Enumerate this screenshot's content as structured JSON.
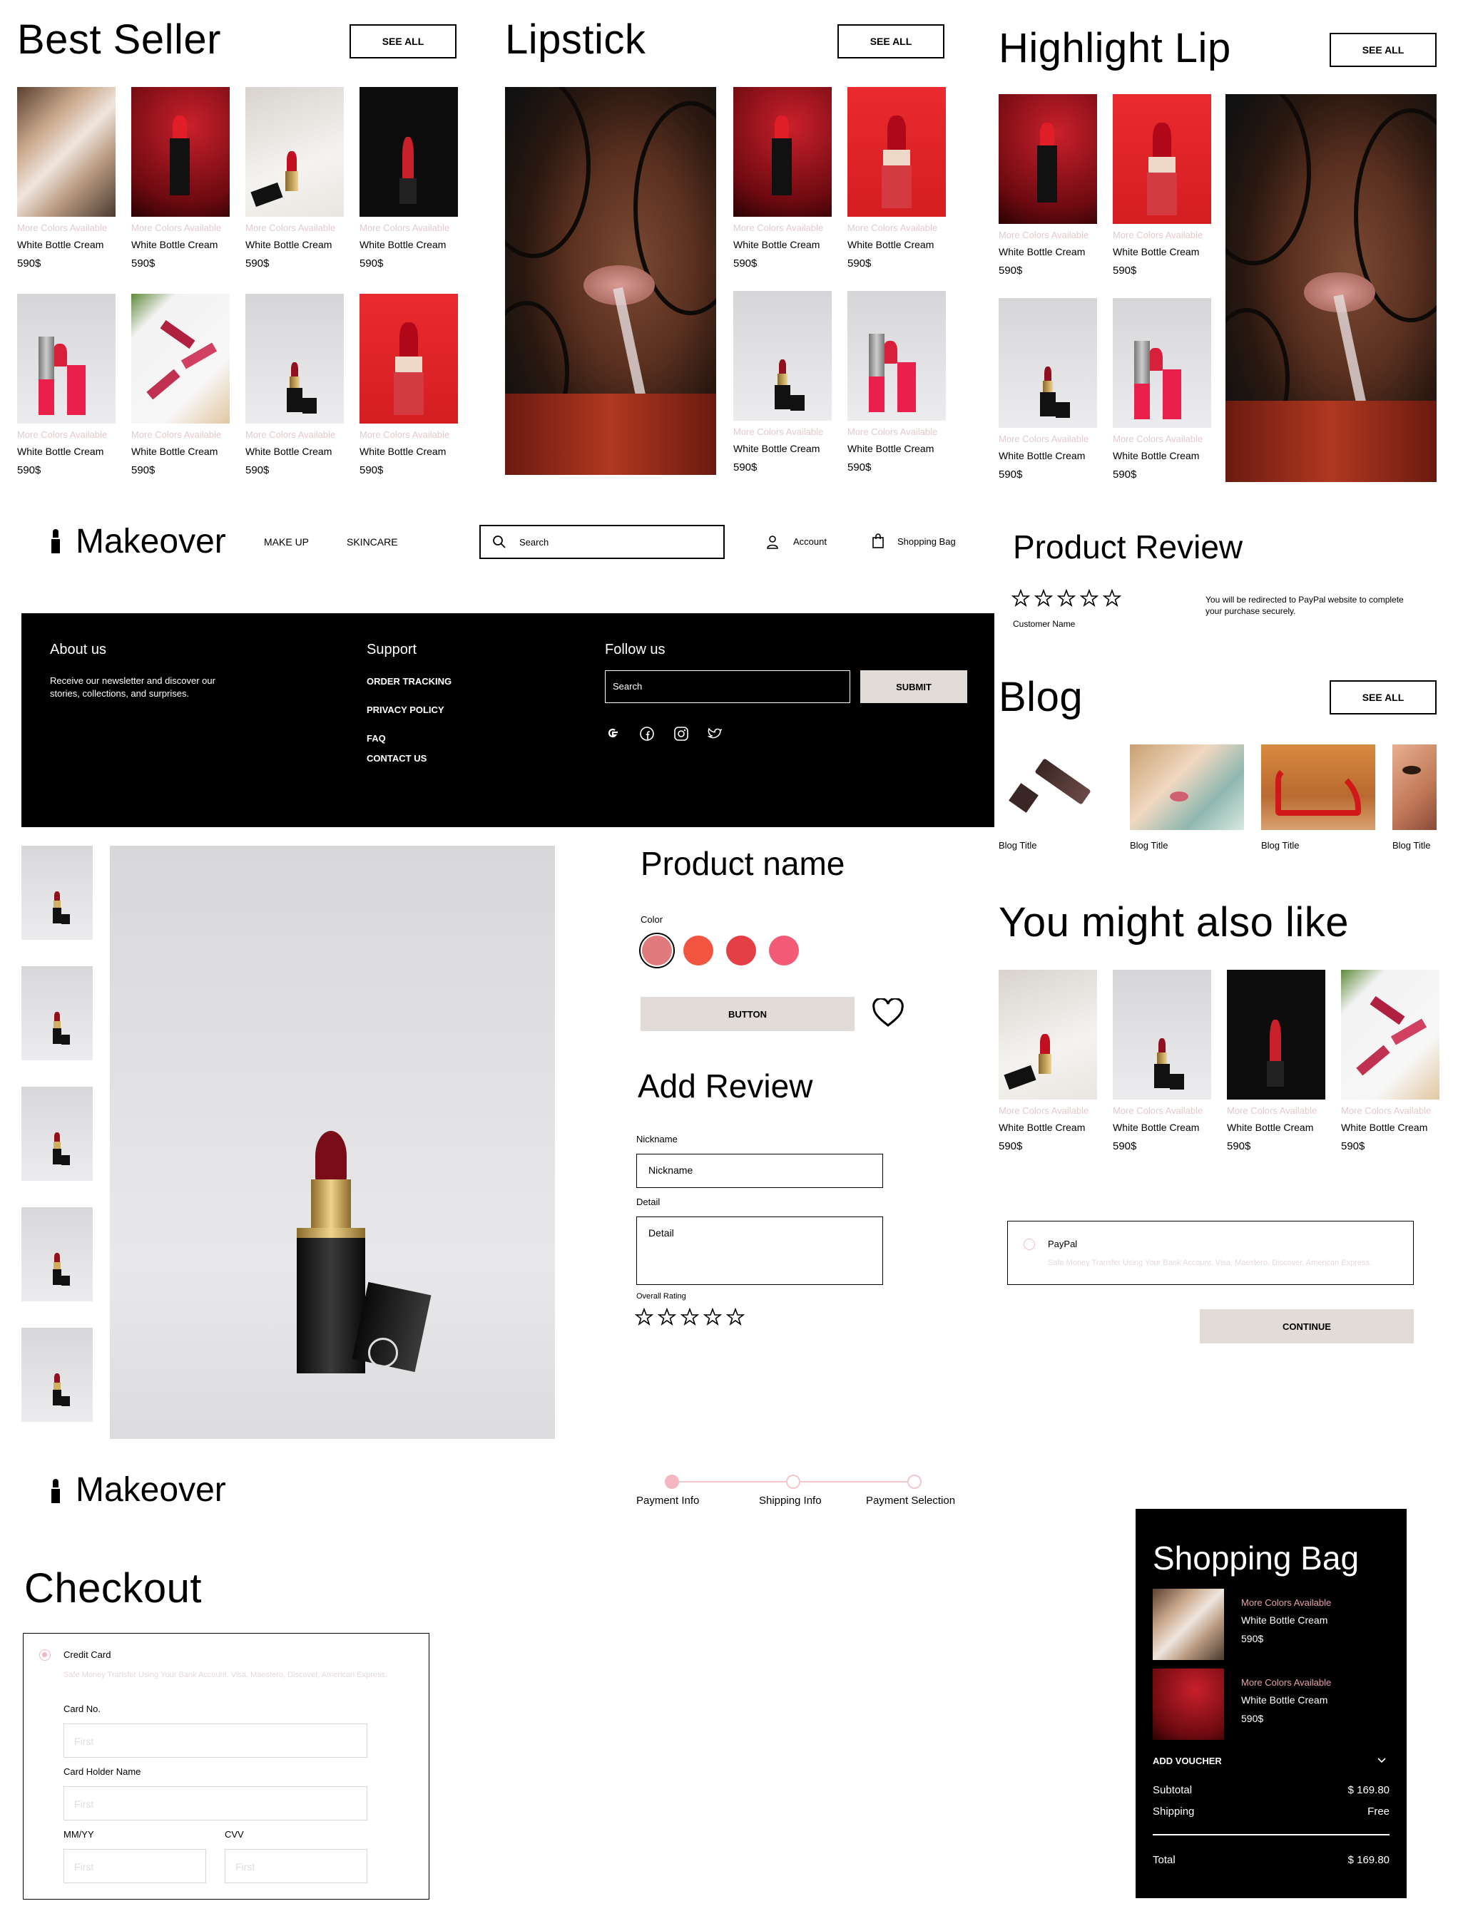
{
  "brand": {
    "name": "Makeover"
  },
  "card": {
    "more_colors": "More Colors Available",
    "name": "White Bottle Cream",
    "price": "590$"
  },
  "best_seller": {
    "title": "Best Seller",
    "see_all": "SEE ALL"
  },
  "lipstick": {
    "title": "Lipstick",
    "see_all": "SEE ALL"
  },
  "highlight": {
    "title": "Highlight Lip",
    "see_all": "SEE ALL"
  },
  "nav": {
    "makeup": "MAKE UP",
    "skincare": "SKINCARE",
    "search_placeholder": "Search",
    "account": "Account",
    "bag": "Shopping Bag"
  },
  "review": {
    "title": "Product Review",
    "customer": "Customer Name",
    "note": "You will be redirected to PayPal website to complete your purchase securely.",
    "stars": 5
  },
  "footer": {
    "about_title": "About us",
    "about_text": "Receive our newsletter and discover our stories, collections, and surprises.",
    "support_title": "Support",
    "support_links": [
      "ORDER TRACKING",
      "PRIVACY POLICY",
      "FAQ",
      "CONTACT US"
    ],
    "follow_title": "Follow us",
    "search_placeholder": "Search",
    "submit": "SUBMIT",
    "social_icons": [
      "google-icon",
      "facebook-icon",
      "instagram-icon",
      "twitter-icon"
    ]
  },
  "blog": {
    "title": "Blog",
    "see_all": "SEE ALL",
    "items": [
      "Blog Title",
      "Blog Title",
      "Blog Title",
      "Blog Title"
    ]
  },
  "product": {
    "name": "Product name",
    "color_label": "Color",
    "colors": [
      "#e07a7c",
      "#f2553f",
      "#e53f46",
      "#f25a75"
    ],
    "button": "BUTTON"
  },
  "add_review": {
    "title": "Add Review",
    "nickname_label": "Nickname",
    "nickname_placeholder": "Nickname",
    "detail_label": "Detail",
    "detail_placeholder": "Detail",
    "rating_label": "Overall Rating"
  },
  "also_like": {
    "title": "You might also like"
  },
  "paypal": {
    "label": "PayPal",
    "desc": "Safe Money Transfer Using Your Bank Account. Visa, Maestero, Discover, American Express.",
    "continue": "CONTINUE"
  },
  "steps": [
    "Payment Info",
    "Shipping Info",
    "Payment Selection"
  ],
  "checkout": {
    "title": "Checkout",
    "credit_card": "Credit Card",
    "desc": "Safe Money Transfer Using Your Bank Account. Visa, Maestero, Discover, American Express.",
    "card_no": "Card No.",
    "holder": "Card Holder Name",
    "mmyy": "MM/YY",
    "cvv": "CVV",
    "placeholder": "First"
  },
  "bag": {
    "title": "Shopping Bag",
    "items": [
      {
        "more_colors": "More Colors Available",
        "name": "White Bottle Cream",
        "price": "590$"
      },
      {
        "more_colors": "More Colors Available",
        "name": "White Bottle Cream",
        "price": "590$"
      }
    ],
    "voucher": "ADD VOUCHER",
    "subtotal_label": "Subtotal",
    "subtotal": "$ 169.80",
    "shipping_label": "Shipping",
    "shipping": "Free",
    "total_label": "Total",
    "total": "$ 169.80"
  },
  "colors": {
    "accent_pink": "#e8a2aa",
    "beige_button": "#e2dcd8",
    "black": "#000000"
  }
}
